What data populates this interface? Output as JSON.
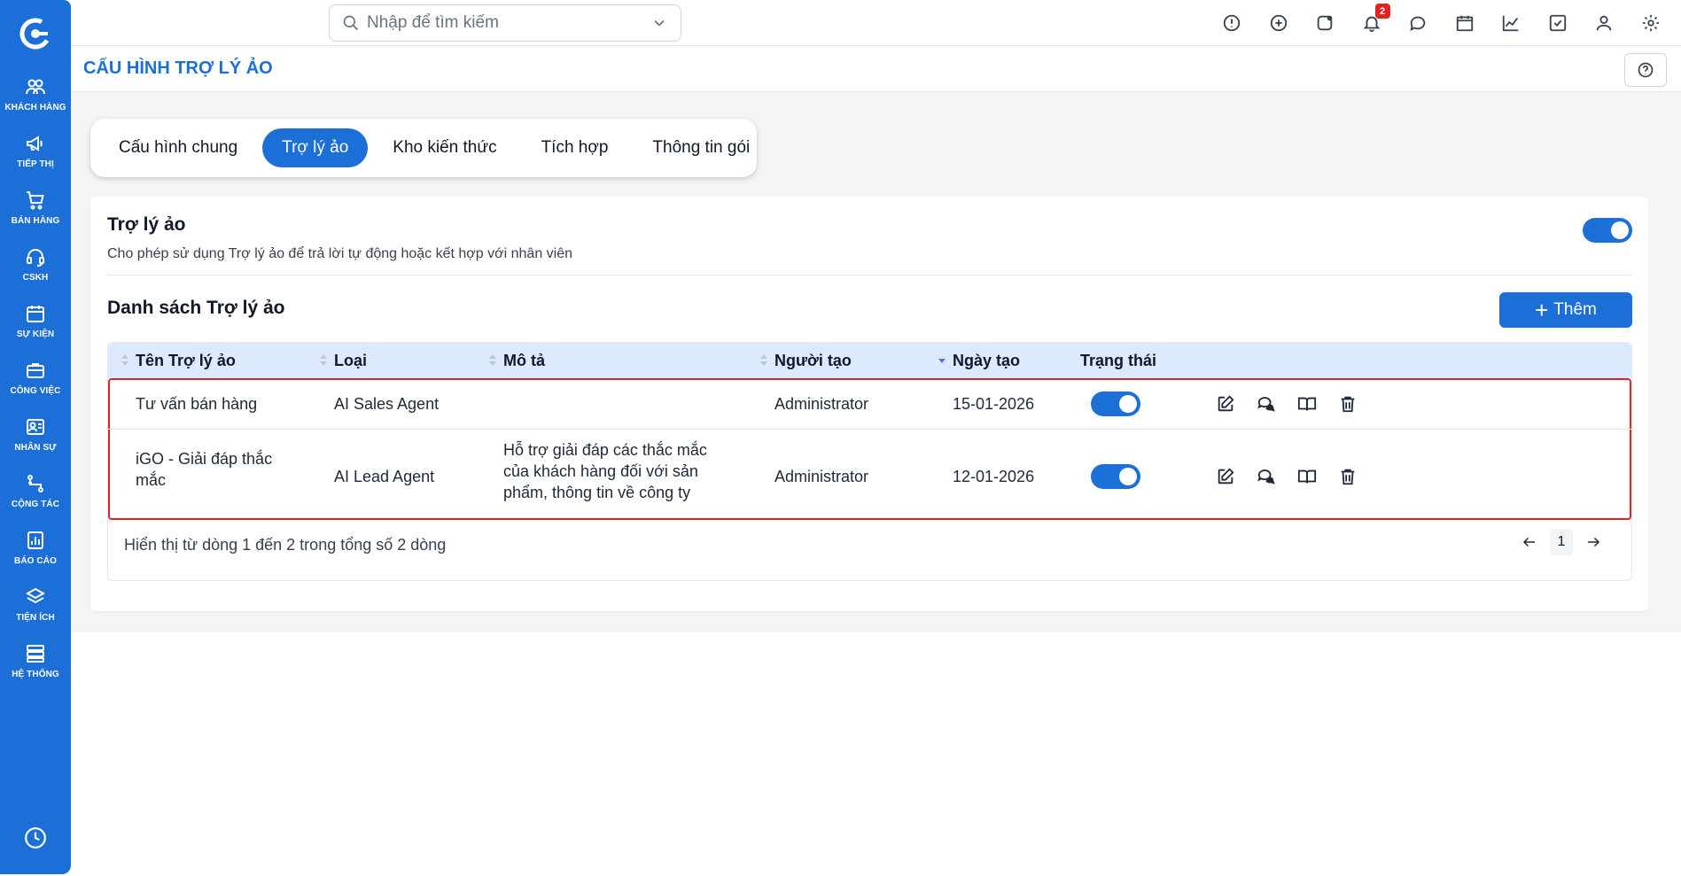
{
  "search": {
    "placeholder": "Nhập để tìm kiếm"
  },
  "notifications": {
    "count": "2"
  },
  "sidebar": {
    "items": [
      {
        "label": "KHÁCH HÀNG",
        "icon": "users-icon"
      },
      {
        "label": "TIẾP THỊ",
        "icon": "megaphone-icon"
      },
      {
        "label": "BÁN HÀNG",
        "icon": "cart-icon"
      },
      {
        "label": "CSKH",
        "icon": "headset-icon"
      },
      {
        "label": "SỰ KIỆN",
        "icon": "calendar-icon"
      },
      {
        "label": "CÔNG VIỆC",
        "icon": "briefcase-icon"
      },
      {
        "label": "NHÂN SỰ",
        "icon": "id-card-icon"
      },
      {
        "label": "CỘNG TÁC",
        "icon": "collaboration-icon"
      },
      {
        "label": "BÁO CÁO",
        "icon": "report-icon"
      },
      {
        "label": "TIỆN ÍCH",
        "icon": "layers-icon"
      },
      {
        "label": "HỆ THỐNG",
        "icon": "server-icon"
      }
    ]
  },
  "page": {
    "title": "CẤU HÌNH TRỢ LÝ ẢO"
  },
  "tabs": [
    {
      "label": "Cấu hình chung",
      "active": false
    },
    {
      "label": "Trợ lý ảo",
      "active": true
    },
    {
      "label": "Kho kiến thức",
      "active": false
    },
    {
      "label": "Tích hợp",
      "active": false
    },
    {
      "label": "Thông tin gói",
      "active": false
    }
  ],
  "assistant_section": {
    "title": "Trợ lý ảo",
    "description": "Cho phép sử dụng Trợ lý ảo để trả lời tự động hoặc kết hợp với nhân viên",
    "enabled": true
  },
  "list": {
    "title": "Danh sách Trợ lý ảo",
    "add_label": "Thêm",
    "columns": [
      "Tên Trợ lý ảo",
      "Loại",
      "Mô tả",
      "Người tạo",
      "Ngày tạo",
      "Trạng thái"
    ],
    "rows": [
      {
        "name": "Tư vấn bán hàng",
        "type": "AI Sales Agent",
        "description": "",
        "creator": "Administrator",
        "created": "15-01-2026",
        "active": true
      },
      {
        "name": "iGO - Giải đáp thắc mắc",
        "type": "AI Lead Agent",
        "description": "Hỗ trợ giải đáp các thắc mắc của khách hàng đối với sản phẩm, thông tin về công ty",
        "creator": "Administrator",
        "created": "12-01-2026",
        "active": true
      }
    ],
    "footer": "Hiển thị từ dòng 1 đến 2 trong tổng số 2 dòng",
    "current_page": "1"
  },
  "colors": {
    "brand": "#1d6fd8",
    "highlight": "#e02424",
    "header_bg": "#dbeafe"
  }
}
